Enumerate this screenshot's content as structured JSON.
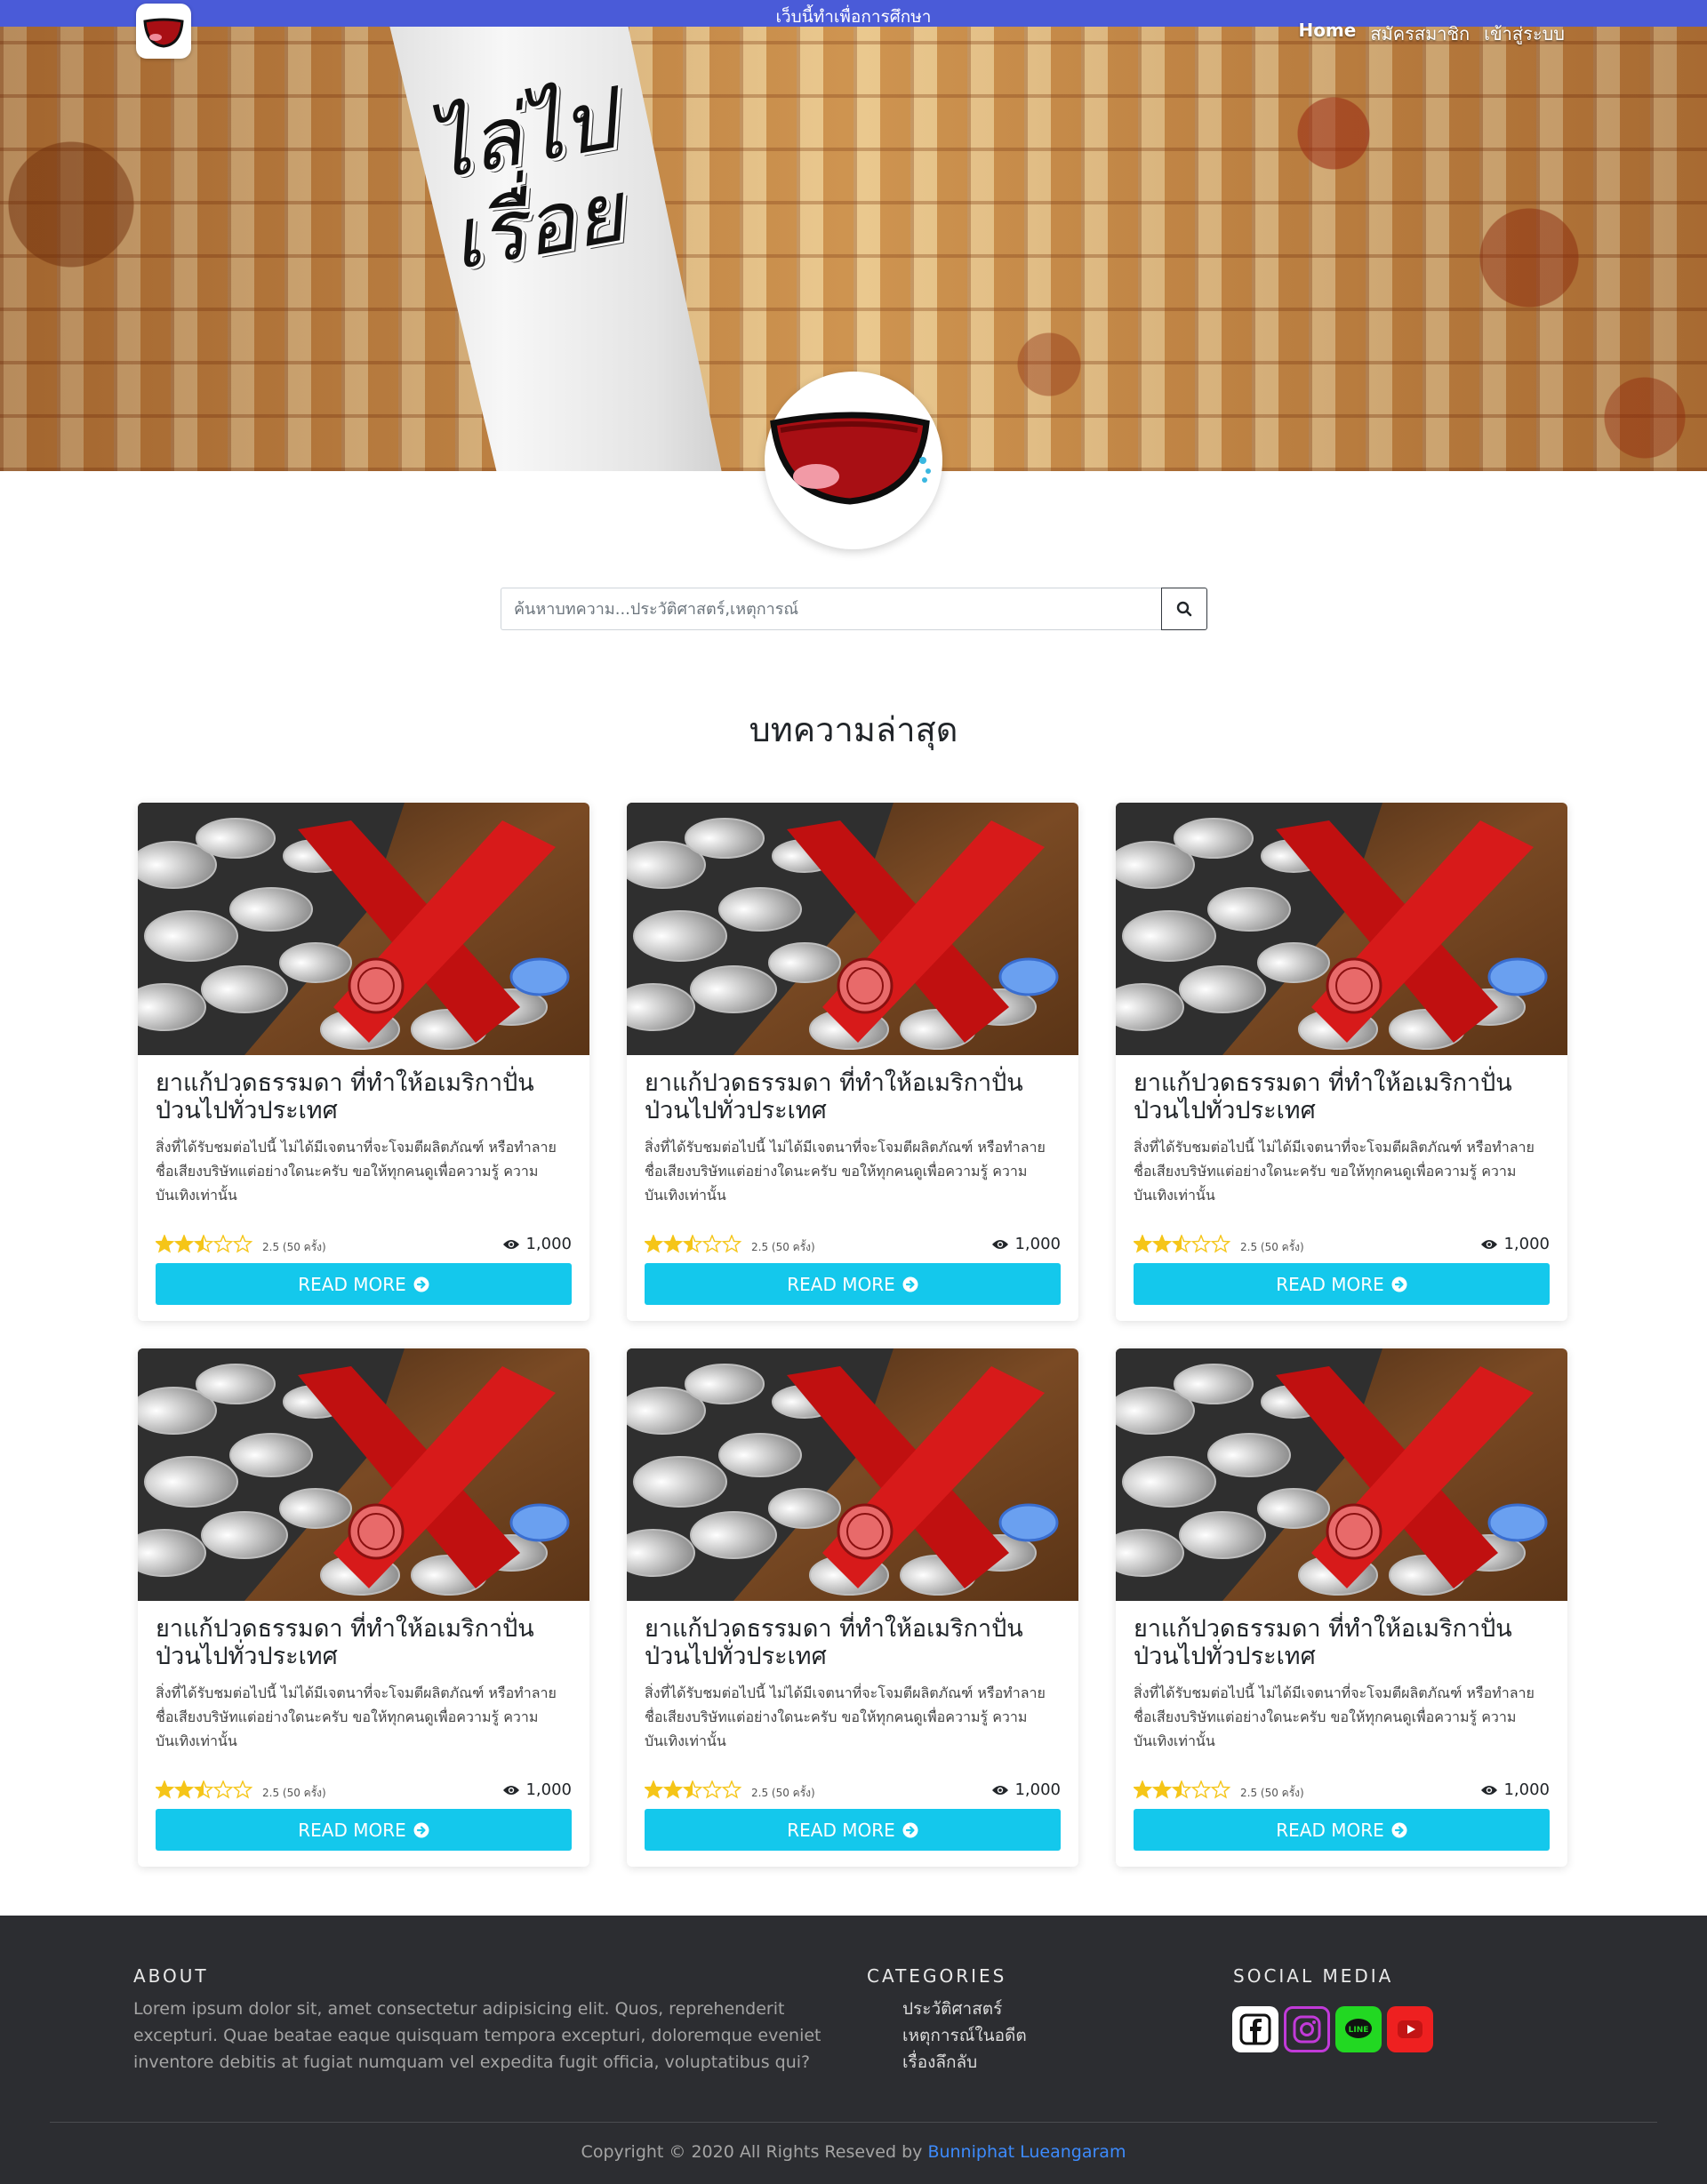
{
  "topbar": {
    "text": "เว็บนี้ทำเพื่อการศึกษา"
  },
  "hero": {
    "title_text": "ไล่ไปเรื่อย"
  },
  "nav": [
    {
      "label": "Home",
      "active": true
    },
    {
      "label": "สมัครสมาชิก",
      "active": false
    },
    {
      "label": "เข้าสู่ระบบ",
      "active": false
    }
  ],
  "search": {
    "placeholder": "ค้นหาบทความ...ประวัติศาสตร์,เหตุการณ์",
    "icon": "search-icon"
  },
  "section": {
    "title": "บทความล่าสุด"
  },
  "cards": [
    {
      "title": "ยาแก้ปวดธรรมดา ที่ทำให้อเมริกาปั่นป่วนไปทั่วประเทศ",
      "text": "สิ่งที่ได้รับชมต่อไปนี้ ไม่ได้มีเจตนาที่จะโจมตีผลิตภัณฑ์ หรือทำลายชื่อเสียงบริษัทแต่อย่างใดนะครับ ขอให้ทุกคนดูเพื่อความรู้ ความบันเทิงเท่านั้น",
      "rating_value": 2.5,
      "rating_text": "2.5 (50 ครั้ง)",
      "views": "1,000",
      "button": "READ MORE"
    },
    {
      "title": "ยาแก้ปวดธรรมดา ที่ทำให้อเมริกาปั่นป่วนไปทั่วประเทศ",
      "text": "สิ่งที่ได้รับชมต่อไปนี้ ไม่ได้มีเจตนาที่จะโจมตีผลิตภัณฑ์ หรือทำลายชื่อเสียงบริษัทแต่อย่างใดนะครับ ขอให้ทุกคนดูเพื่อความรู้ ความบันเทิงเท่านั้น",
      "rating_value": 2.5,
      "rating_text": "2.5 (50 ครั้ง)",
      "views": "1,000",
      "button": "READ MORE"
    },
    {
      "title": "ยาแก้ปวดธรรมดา ที่ทำให้อเมริกาปั่นป่วนไปทั่วประเทศ",
      "text": "สิ่งที่ได้รับชมต่อไปนี้ ไม่ได้มีเจตนาที่จะโจมตีผลิตภัณฑ์ หรือทำลายชื่อเสียงบริษัทแต่อย่างใดนะครับ ขอให้ทุกคนดูเพื่อความรู้ ความบันเทิงเท่านั้น",
      "rating_value": 2.5,
      "rating_text": "2.5 (50 ครั้ง)",
      "views": "1,000",
      "button": "READ MORE"
    },
    {
      "title": "ยาแก้ปวดธรรมดา ที่ทำให้อเมริกาปั่นป่วนไปทั่วประเทศ",
      "text": "สิ่งที่ได้รับชมต่อไปนี้ ไม่ได้มีเจตนาที่จะโจมตีผลิตภัณฑ์ หรือทำลายชื่อเสียงบริษัทแต่อย่างใดนะครับ ขอให้ทุกคนดูเพื่อความรู้ ความบันเทิงเท่านั้น",
      "rating_value": 2.5,
      "rating_text": "2.5 (50 ครั้ง)",
      "views": "1,000",
      "button": "READ MORE"
    },
    {
      "title": "ยาแก้ปวดธรรมดา ที่ทำให้อเมริกาปั่นป่วนไปทั่วประเทศ",
      "text": "สิ่งที่ได้รับชมต่อไปนี้ ไม่ได้มีเจตนาที่จะโจมตีผลิตภัณฑ์ หรือทำลายชื่อเสียงบริษัทแต่อย่างใดนะครับ ขอให้ทุกคนดูเพื่อความรู้ ความบันเทิงเท่านั้น",
      "rating_value": 2.5,
      "rating_text": "2.5 (50 ครั้ง)",
      "views": "1,000",
      "button": "READ MORE"
    },
    {
      "title": "ยาแก้ปวดธรรมดา ที่ทำให้อเมริกาปั่นป่วนไปทั่วประเทศ",
      "text": "สิ่งที่ได้รับชมต่อไปนี้ ไม่ได้มีเจตนาที่จะโจมตีผลิตภัณฑ์ หรือทำลายชื่อเสียงบริษัทแต่อย่างใดนะครับ ขอให้ทุกคนดูเพื่อความรู้ ความบันเทิงเท่านั้น",
      "rating_value": 2.5,
      "rating_text": "2.5 (50 ครั้ง)",
      "views": "1,000",
      "button": "READ MORE"
    }
  ],
  "footer": {
    "about_title": "ABOUT",
    "about_text": "Lorem ipsum dolor sit, amet consectetur adipisicing elit. Quos, reprehenderit excepturi. Quae beatae eaque quisquam tempora excepturi, doloremque eveniet inventore debitis at fugiat numquam vel expedita fugit officia, voluptatibus qui?",
    "categories_title": "CATEGORIES",
    "categories": [
      "ประวัติศาสตร์",
      "เหตุการณ์ในอดีต",
      "เรื่องลึกลับ"
    ],
    "social_title": "SOCIAL MEDIA",
    "social": [
      {
        "icon": "facebook-icon",
        "color": "#ffffff"
      },
      {
        "icon": "instagram-icon",
        "color": "#c13ad8"
      },
      {
        "icon": "line-icon",
        "color": "#22d822"
      },
      {
        "icon": "youtube-icon",
        "color": "#ee2020"
      }
    ],
    "copyright_prefix": "Copyright © 2020 All Rights Reseved by",
    "copyright_author": "Bunniphat Lueangaram"
  },
  "colors": {
    "topbar": "#4a5bd8",
    "button": "#14c8ec",
    "footer": "#2c2d31",
    "link": "#3d8bfd",
    "star": "#f5c518"
  }
}
